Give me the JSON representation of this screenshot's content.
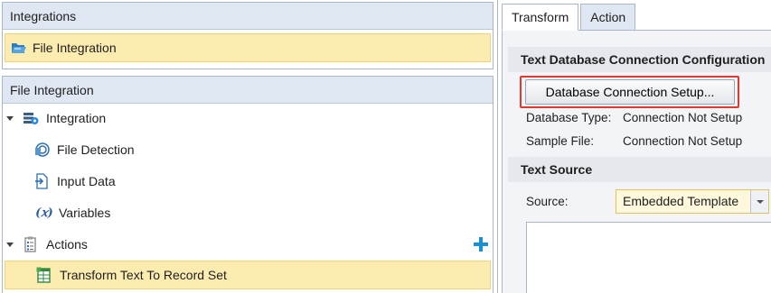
{
  "integrations_panel": {
    "header": "Integrations",
    "selected_item": "File Integration"
  },
  "file_integration_panel": {
    "header": "File Integration",
    "tree": {
      "integration_label": "Integration",
      "file_detection_label": "File Detection",
      "input_data_label": "Input Data",
      "variables_label": "Variables",
      "actions_label": "Actions",
      "transform_label": "Transform Text To Record Set"
    }
  },
  "tabs": {
    "transform": "Transform",
    "action": "Action"
  },
  "config": {
    "section_title": "Text Database Connection Configuration",
    "db_button_label": "Database Connection Setup...",
    "database_type_label": "Database Type:",
    "database_type_value": "Connection Not Setup",
    "sample_file_label": "Sample File:",
    "sample_file_value": "Connection Not Setup"
  },
  "text_source": {
    "section_title": "Text Source",
    "source_label": "Source:",
    "source_value": "Embedded Template"
  },
  "colors": {
    "header_bg": "#dfe7f2",
    "selection_bg": "#fdecb0",
    "highlight_border": "#e03a2e",
    "add_icon": "#1a8fd6"
  }
}
